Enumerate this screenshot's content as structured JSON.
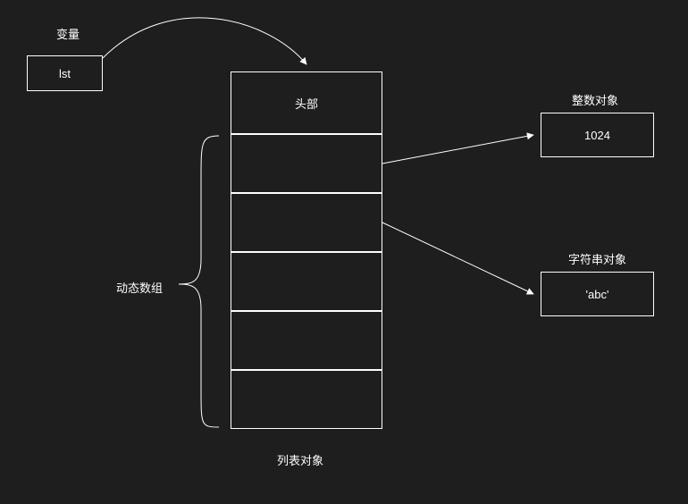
{
  "variable": {
    "title": "变量",
    "name": "lst"
  },
  "list": {
    "header": "头部",
    "caption": "列表对象",
    "dynamic_array_label": "动态数组"
  },
  "objects": {
    "integer": {
      "title": "整数对象",
      "value": "1024"
    },
    "string": {
      "title": "字符串对象",
      "value": "'abc'"
    }
  }
}
